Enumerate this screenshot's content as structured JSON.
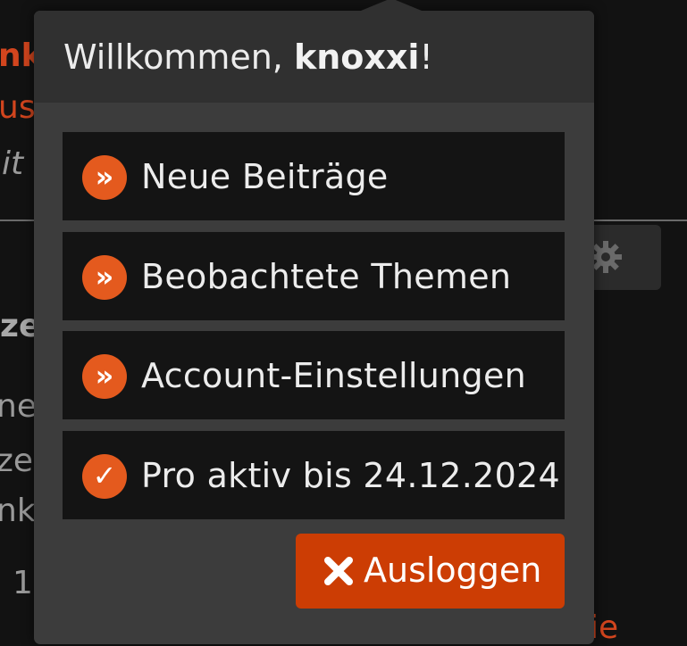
{
  "background": {
    "fragments": [
      "nk",
      "us",
      "it",
      "ze",
      "ne",
      "ze",
      "nk",
      "1,",
      "ie"
    ]
  },
  "popup": {
    "welcome_prefix": "Willkommen, ",
    "username": "knoxxi",
    "welcome_suffix": "!",
    "menu": [
      {
        "label": "Neue Beiträge",
        "icon_glyph": "»",
        "icon": "double-chevron-icon"
      },
      {
        "label": "Beobachtete Themen",
        "icon_glyph": "»",
        "icon": "double-chevron-icon"
      },
      {
        "label": "Account-Einstellungen",
        "icon_glyph": "»",
        "icon": "double-chevron-icon"
      },
      {
        "label": "Pro aktiv bis 24.12.2024",
        "icon_glyph": "✓",
        "icon": "checkmark-icon"
      }
    ],
    "logout_label": "Ausloggen"
  },
  "colors": {
    "accent": "#e45a1e",
    "logout_bg": "#cc3d04",
    "popup_bg": "#3c3c3c",
    "item_bg": "#141414"
  }
}
